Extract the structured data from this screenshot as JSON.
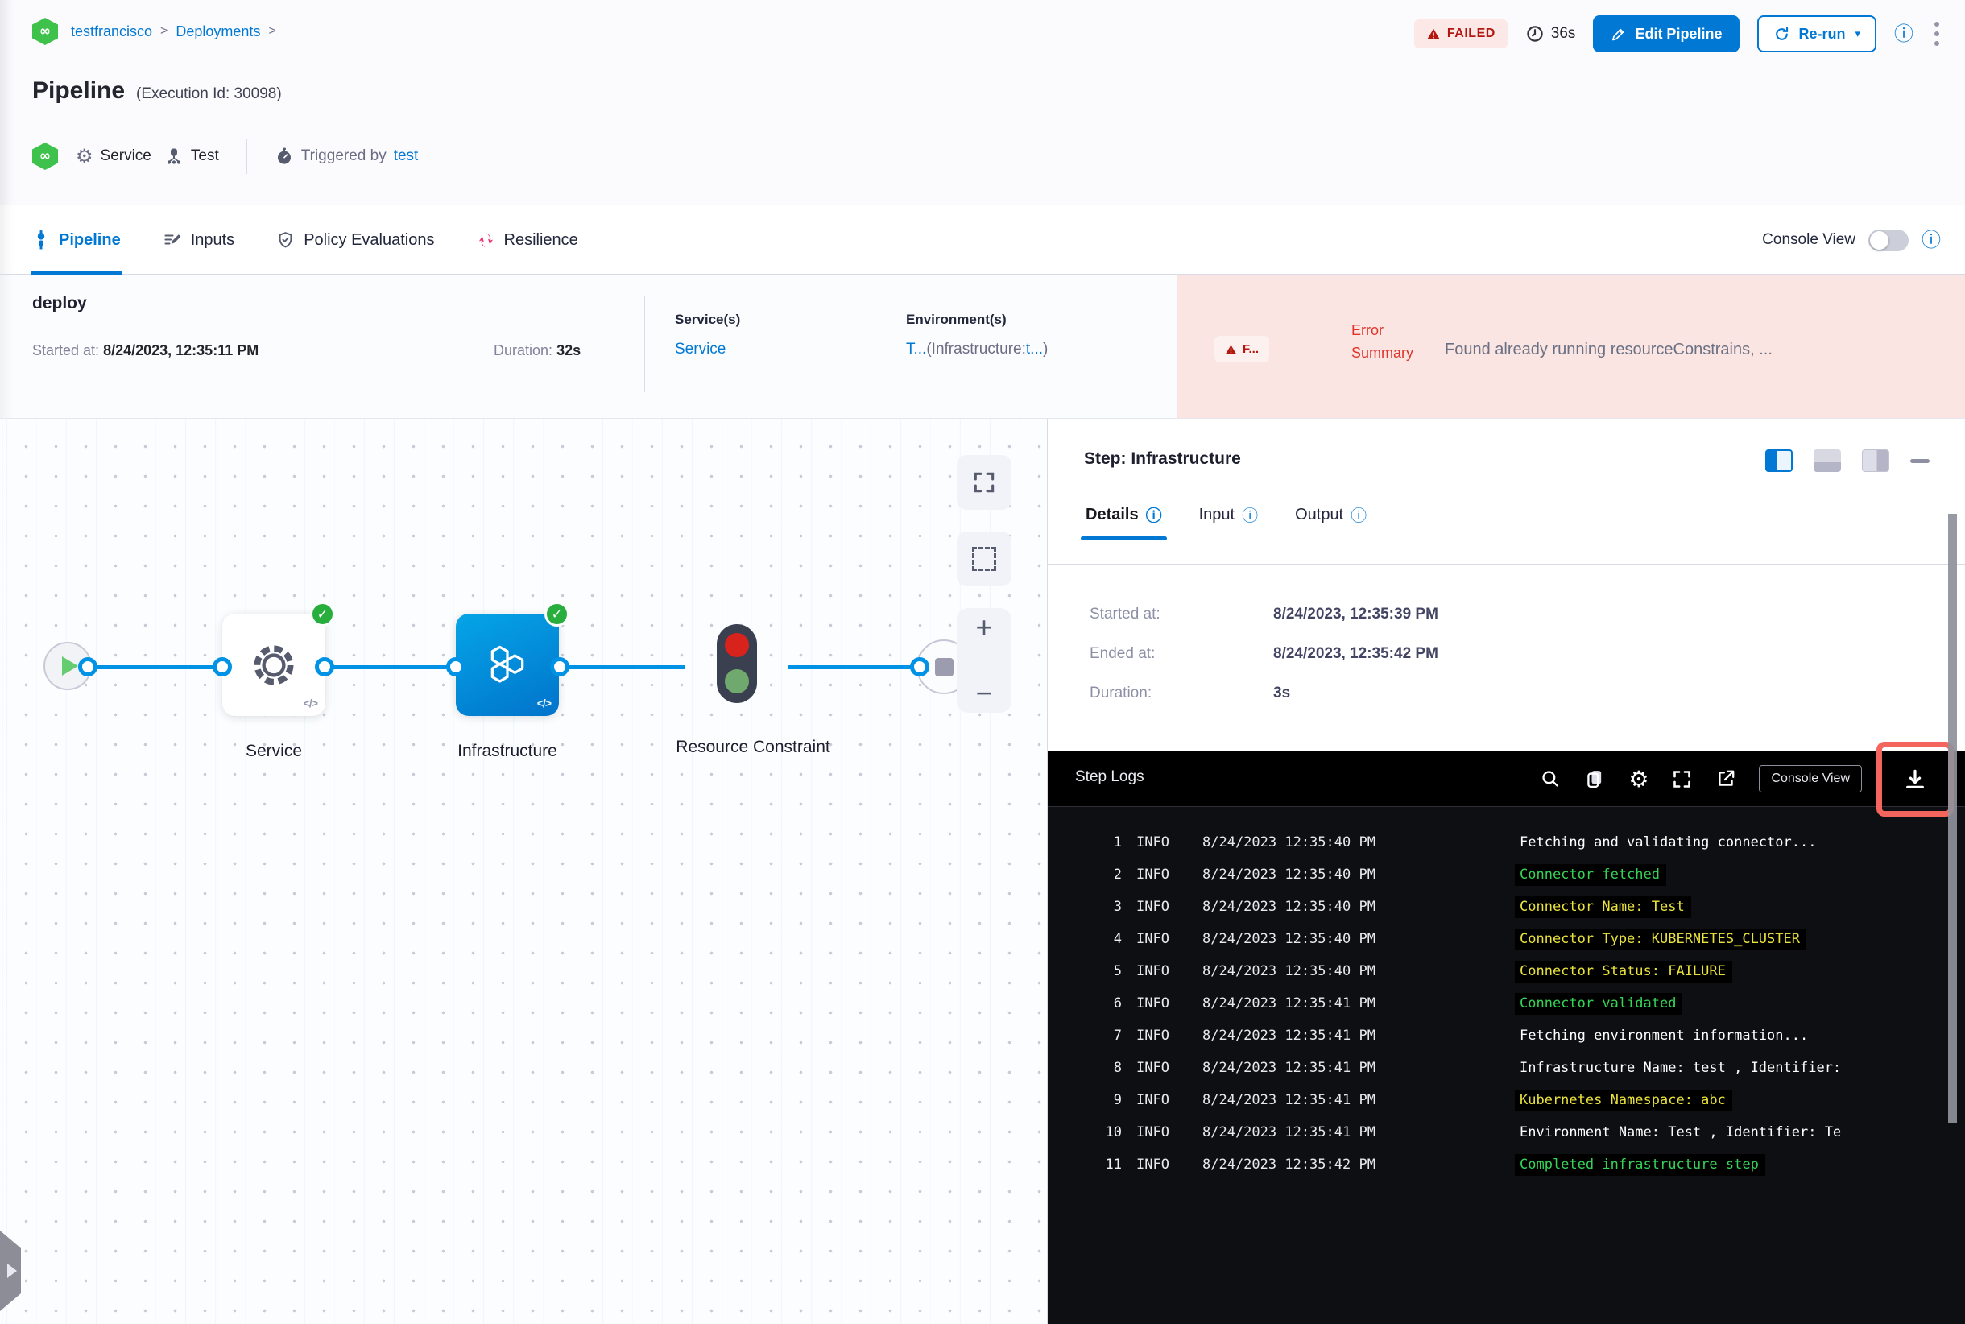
{
  "icons": {
    "infinity": "∞",
    "caret_down": "▾",
    "code": "</>",
    "plus": "+",
    "minus": "−",
    "check": "✓",
    "gear": "⚙",
    "info": "ⓘ",
    "failed_warning": "warning-triangle"
  },
  "header": {
    "breadcrumb": {
      "project": "testfrancisco",
      "section": "Deployments",
      "sep": ">"
    },
    "title": "Pipeline",
    "subtitle": "(Execution Id: 30098)",
    "status_badge": "FAILED",
    "total_duration": "36s",
    "edit_button": "Edit Pipeline",
    "rerun_button": "Re-run",
    "entity": {
      "service_label": "Service",
      "test_label": "Test",
      "triggered_by_label": "Triggered by",
      "triggered_by_user": "test"
    }
  },
  "tabbar": {
    "tabs": [
      {
        "label": "Pipeline"
      },
      {
        "label": "Inputs"
      },
      {
        "label": "Policy Evaluations"
      },
      {
        "label": "Resilience"
      }
    ],
    "console_view_label": "Console View"
  },
  "stage": {
    "name": "deploy",
    "started_label": "Started at:",
    "started_value": "8/24/2023, 12:35:11 PM",
    "duration_label": "Duration:",
    "duration_value": "32s",
    "services_label": "Service(s)",
    "services_value": "Service",
    "environments_label": "Environment(s)",
    "env_part1": "T...",
    "env_part2": "(Infrastructure:",
    "env_part3": "t...",
    "env_part4": ")",
    "error_badge": "F...",
    "error_label_line1": "Error",
    "error_label_line2": "Summary",
    "error_message": "Found already running resourceConstrains, ..."
  },
  "canvas": {
    "nodes": [
      {
        "label": "Service"
      },
      {
        "label": "Infrastructure"
      },
      {
        "label": "Resource Constraint"
      }
    ]
  },
  "panel": {
    "title": "Step: Infrastructure",
    "tabs": [
      {
        "label": "Details"
      },
      {
        "label": "Input"
      },
      {
        "label": "Output"
      }
    ],
    "details": [
      {
        "label": "Started at:",
        "value": "8/24/2023, 12:35:39 PM"
      },
      {
        "label": "Ended at:",
        "value": "8/24/2023, 12:35:42 PM"
      },
      {
        "label": "Duration:",
        "value": "3s"
      }
    ]
  },
  "logs": {
    "title": "Step Logs",
    "console_view_button": "Console View",
    "lines": [
      {
        "num": "1",
        "level": "INFO",
        "time": "8/24/2023 12:35:40 PM",
        "message": "Fetching and validating connector...",
        "color": "white"
      },
      {
        "num": "2",
        "level": "INFO",
        "time": "8/24/2023 12:35:40 PM",
        "message": "Connector fetched",
        "color": "green"
      },
      {
        "num": "3",
        "level": "INFO",
        "time": "8/24/2023 12:35:40 PM",
        "message": "Connector Name: Test",
        "color": "yellow"
      },
      {
        "num": "4",
        "level": "INFO",
        "time": "8/24/2023 12:35:40 PM",
        "message": "Connector Type: KUBERNETES_CLUSTER",
        "color": "yellow"
      },
      {
        "num": "5",
        "level": "INFO",
        "time": "8/24/2023 12:35:40 PM",
        "message": "Connector Status: FAILURE",
        "color": "yellow"
      },
      {
        "num": "6",
        "level": "INFO",
        "time": "8/24/2023 12:35:41 PM",
        "message": "Connector validated",
        "color": "green"
      },
      {
        "num": "7",
        "level": "INFO",
        "time": "8/24/2023 12:35:41 PM",
        "message": "Fetching environment information...",
        "color": "white"
      },
      {
        "num": "8",
        "level": "INFO",
        "time": "8/24/2023 12:35:41 PM",
        "message": "Infrastructure Name: test , Identifier:",
        "color": "white"
      },
      {
        "num": "9",
        "level": "INFO",
        "time": "8/24/2023 12:35:41 PM",
        "message": "Kubernetes Namespace: abc",
        "color": "yellow"
      },
      {
        "num": "10",
        "level": "INFO",
        "time": "8/24/2023 12:35:41 PM",
        "message": "Environment Name: Test , Identifier: Te",
        "color": "white"
      },
      {
        "num": "11",
        "level": "INFO",
        "time": "8/24/2023 12:35:42 PM",
        "message": "Completed infrastructure step",
        "color": "green"
      }
    ]
  },
  "colors": {
    "primary_blue": "#0278d5",
    "connector_blue": "#0092e4",
    "failed_red": "#b41710",
    "error_bg_pink": "#fbe5e2",
    "success_green": "#27ae3c",
    "log_green": "#35d355",
    "log_yellow": "#e9e23c",
    "highlight_red_box": "#f4655e"
  }
}
